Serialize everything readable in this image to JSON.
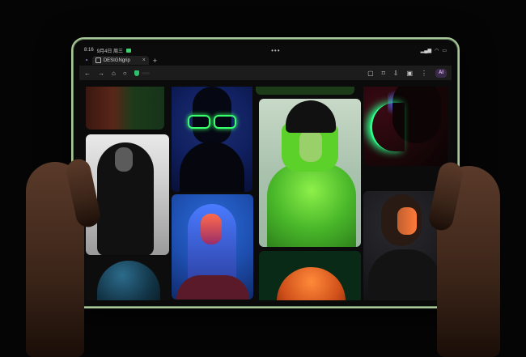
{
  "status_bar": {
    "time": "8:16",
    "date": "9月4日 周三",
    "center_dots": "•••"
  },
  "browser": {
    "tab": {
      "title": "DESIGNgrip",
      "close": "×"
    },
    "new_tab": "+",
    "toolbar": {
      "back": "←",
      "forward": "→",
      "home": "⌂",
      "reload": "○",
      "ai_label": "AI"
    }
  },
  "page": {
    "content": "masonry photo gallery",
    "accent_colors": [
      "#38ff6c",
      "#5bd12a",
      "#2a6bd6",
      "#ff8a3a"
    ]
  },
  "device": {
    "frame_color": "#a9c79a"
  }
}
